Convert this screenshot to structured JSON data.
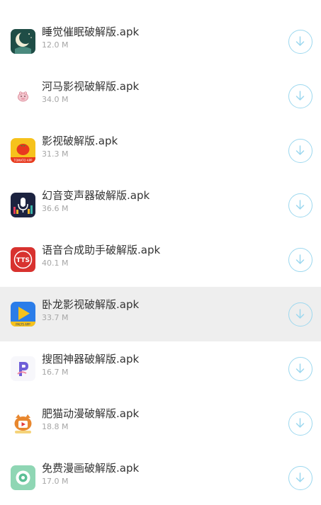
{
  "items": [
    {
      "name": "睡觉催眠破解版.apk",
      "size": "12.0 M",
      "icon": "sleep-moon-icon"
    },
    {
      "name": "河马影视破解版.apk",
      "size": "34.0 M",
      "icon": "hippo-icon"
    },
    {
      "name": "影视破解版.apk",
      "size": "31.3 M",
      "icon": "tomato-icon",
      "icon_caption": "TOMATO APP"
    },
    {
      "name": "幻音变声器破解版.apk",
      "size": "36.6 M",
      "icon": "microphone-icon"
    },
    {
      "name": "语音合成助手破解版.apk",
      "size": "40.1 M",
      "icon": "tts-icon",
      "icon_caption": "TTS"
    },
    {
      "name": "卧龙影视破解版.apk",
      "size": "33.7 M",
      "icon": "play-icon",
      "icon_caption": "PALYS APP",
      "highlighted": true
    },
    {
      "name": "搜图神器破解版.apk",
      "size": "16.7 M",
      "icon": "letter-p-icon"
    },
    {
      "name": "肥猫动漫破解版.apk",
      "size": "18.8 M",
      "icon": "cat-icon"
    },
    {
      "name": "免费漫画破解版.apk",
      "size": "17.0 M",
      "icon": "green-circle-icon"
    }
  ],
  "download_icon": "download-arrow-icon",
  "colors": {
    "accent": "#9dd8ef",
    "title": "#333333",
    "subtitle": "#a6a6a6",
    "highlight_row": "#eeeeee"
  }
}
